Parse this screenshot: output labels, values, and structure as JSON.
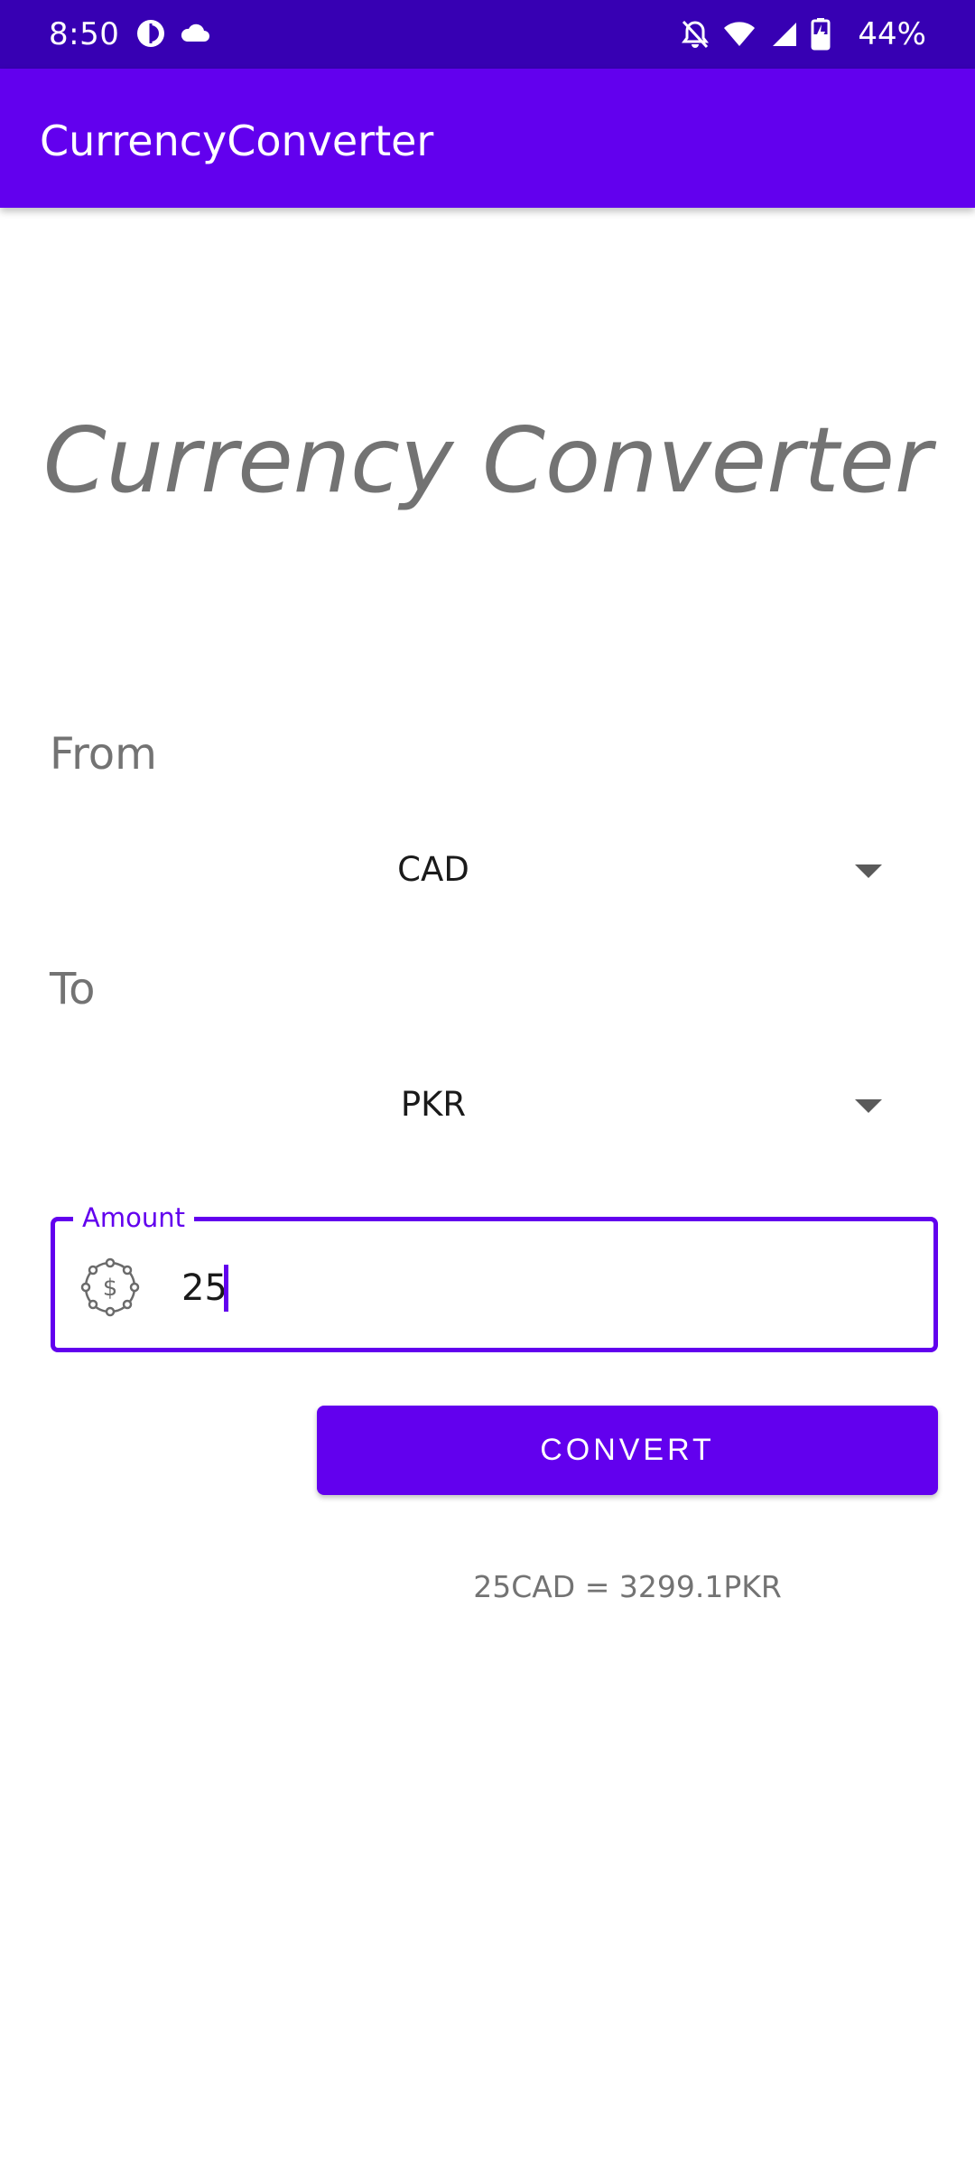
{
  "status_bar": {
    "time": "8:50",
    "battery_percent": "44%",
    "left_icons": [
      "app-notification-icon",
      "cloud-icon"
    ],
    "right_icons": [
      "notifications-off-icon",
      "wifi-icon",
      "signal-icon",
      "battery-charging-icon"
    ]
  },
  "app_bar": {
    "title": "CurrencyConverter"
  },
  "main": {
    "heading": "Currency Converter",
    "from_label": "From",
    "from_currency": "CAD",
    "to_label": "To",
    "to_currency": "PKR",
    "amount": {
      "label": "Amount",
      "value": "25",
      "icon": "dollar-badge-icon"
    },
    "convert_label": "CONVERT",
    "result": "25CAD = 3299.1PKR"
  },
  "colors": {
    "status_bar": "#3700b3",
    "primary": "#6200ee",
    "secondary_text": "#737373"
  }
}
